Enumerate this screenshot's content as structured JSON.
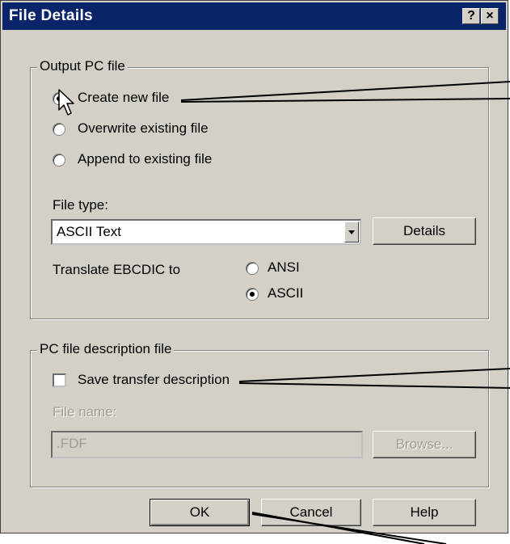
{
  "window": {
    "title": "File Details",
    "help_label": "?",
    "close_label": "×"
  },
  "output_group": {
    "legend": "Output PC file",
    "options": [
      {
        "label": "Create new file",
        "selected": true
      },
      {
        "label": "Overwrite existing file",
        "selected": false
      },
      {
        "label": "Append to existing file",
        "selected": false
      }
    ],
    "file_type_label": "File type:",
    "file_type_value": "ASCII Text",
    "details_button": "Details",
    "translate_label": "Translate EBCDIC to",
    "translate_options": [
      {
        "label": "ANSI",
        "selected": false
      },
      {
        "label": "ASCII",
        "selected": true
      }
    ]
  },
  "description_group": {
    "legend": "PC file description file",
    "save_checkbox_label": "Save transfer description",
    "save_checked": false,
    "file_name_label": "File name:",
    "file_name_value": ".FDF",
    "browse_button": "Browse..."
  },
  "buttons": {
    "ok": "OK",
    "cancel": "Cancel",
    "help": "Help"
  },
  "colors": {
    "titlebar": "#0a246a",
    "face": "#d4d0c8",
    "disabled_text": "#a09c94"
  }
}
